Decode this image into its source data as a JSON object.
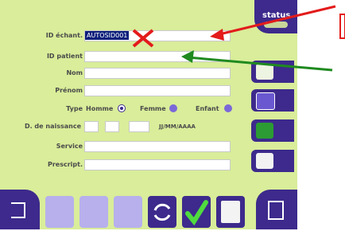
{
  "form": {
    "sample_id_label": "ID échant.",
    "sample_id_value": "AUTOSID001",
    "patient_id_label": "ID patient",
    "name_label": "Nom",
    "firstname_label": "Prénom",
    "type_label": "Type",
    "type_male": "Homme",
    "type_female": "Femme",
    "type_child": "Enfant",
    "dob_label": "D. de naissance",
    "dob_format": "JJ/MM/AAAA",
    "service_label": "Service",
    "prescript_label": "Prescript."
  },
  "status": {
    "label": "status"
  },
  "colors": {
    "screen": "#d9ed9a",
    "accent": "#3d2a8c",
    "selected": "#0b1f7a",
    "red_arrow": "#e31b1b",
    "green_arrow": "#1f8a1f"
  }
}
